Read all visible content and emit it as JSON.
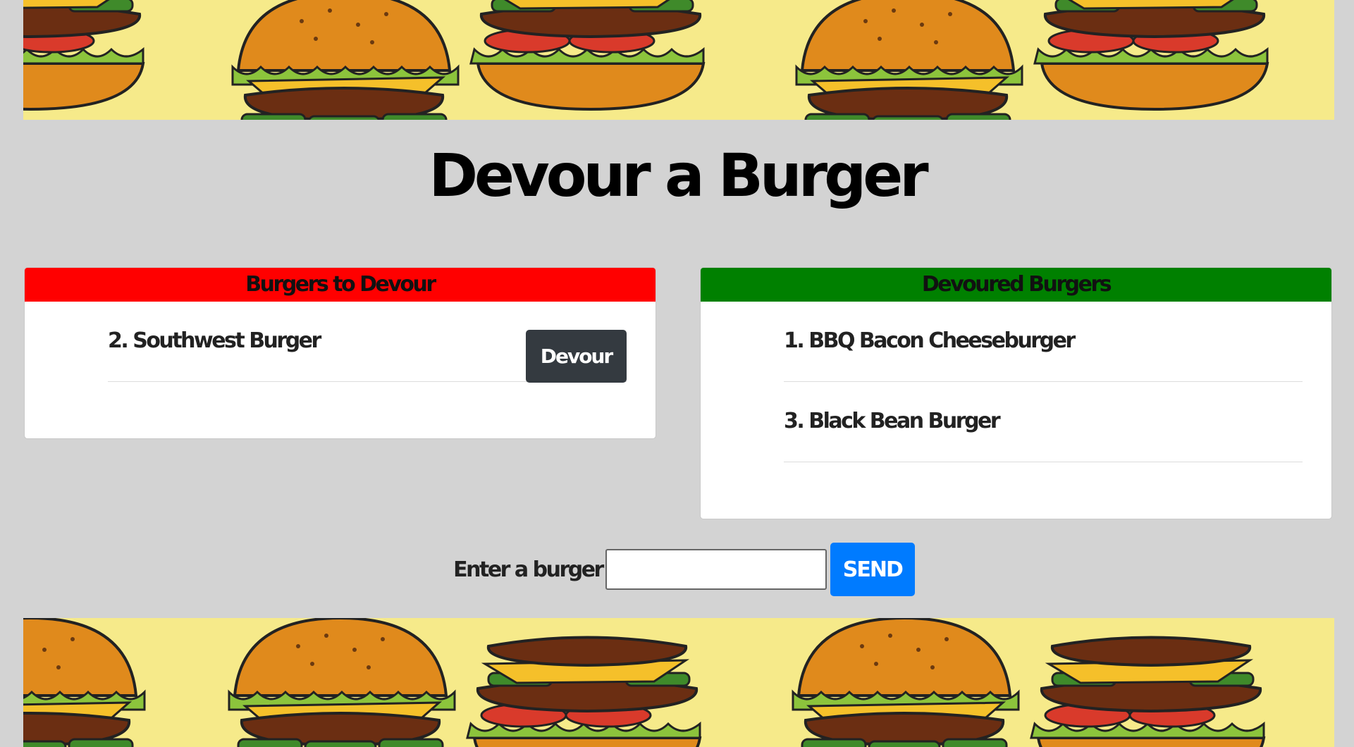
{
  "page_title": "Devour a Burger",
  "to_devour": {
    "header": "Burgers to Devour",
    "items": [
      {
        "label": "2. Southwest Burger",
        "button_label": "Devour"
      }
    ]
  },
  "devoured": {
    "header": "Devoured Burgers",
    "items": [
      {
        "label": "1. BBQ Bacon Cheeseburger"
      },
      {
        "label": "3. Black Bean Burger"
      }
    ]
  },
  "form": {
    "label": "Enter a burger",
    "input_value": "",
    "send_label": "SEND"
  },
  "colors": {
    "page_bg": "#d3d3d3",
    "banner_bg": "#f6ea8a",
    "to_devour_header": "#ff0000",
    "devoured_header": "#008000",
    "devour_button": "#343a40",
    "send_button": "#007bff"
  },
  "icons": {
    "banner_pattern": "burger-icon"
  }
}
